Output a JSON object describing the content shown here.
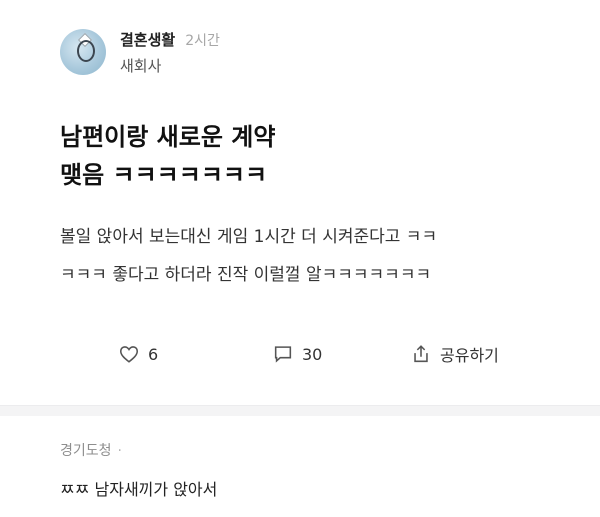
{
  "post": {
    "group_name": "결혼생활",
    "time": "2시간",
    "board_name": "새회사",
    "title": "남편이랑 새로운 계약\n맺음 ㅋㅋㅋㅋㅋㅋㅋ",
    "body": "볼일 앉아서 보는대신 게임 1시간 더 시켜준다고 ㅋㅋ\nㅋㅋㅋ 좋다고 하더라 진작 이럴껄 알ㅋㅋㅋㅋㅋㅋㅋ"
  },
  "actions": {
    "like_count": "6",
    "comment_count": "30",
    "share_label": "공유하기"
  },
  "icons": {
    "like": "heart-icon",
    "comment": "speech-bubble-icon",
    "share": "share-icon"
  },
  "comment": {
    "author": "경기도청",
    "separator": "·",
    "text": "ㅉㅉ 남자새끼가 앉아서"
  }
}
